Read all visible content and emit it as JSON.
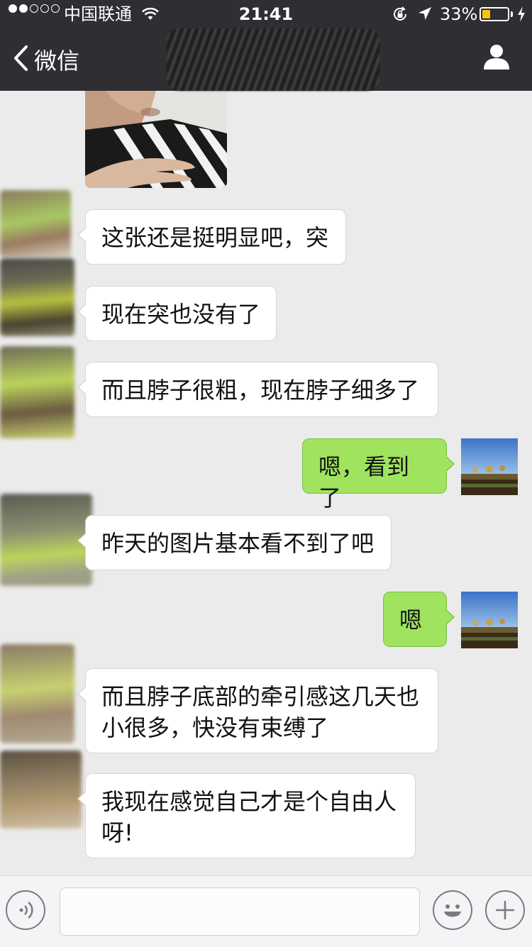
{
  "status_bar": {
    "carrier": "中国联通",
    "time": "21:41",
    "battery_percent": "33%",
    "battery_level": 0.33,
    "signal_bars_filled": 2,
    "signal_bars_total": 5
  },
  "nav": {
    "back_label": "微信",
    "contact_name": ""
  },
  "messages": [
    {
      "side": "in",
      "type": "image"
    },
    {
      "side": "in",
      "text": "这张还是挺明显吧，突"
    },
    {
      "side": "in",
      "text": "现在突也没有了"
    },
    {
      "side": "in",
      "text": "而且脖子很粗，现在脖子细多了"
    },
    {
      "side": "out",
      "text": "嗯，看到了"
    },
    {
      "side": "in",
      "text": "昨天的图片基本看不到了吧"
    },
    {
      "side": "out",
      "text": "嗯"
    },
    {
      "side": "in",
      "text": "而且脖子底部的牵引感这几天也小很多，快没有束缚了"
    },
    {
      "side": "in",
      "text": "我现在感觉自己才是个自由人呀!"
    }
  ],
  "input": {
    "value": "",
    "placeholder": ""
  },
  "icons": {
    "back": "chevron-left-icon",
    "profile": "person-icon",
    "voice": "voice-icon",
    "emoji": "emoji-icon",
    "plus": "plus-icon"
  },
  "colors": {
    "nav_bg": "#2e2e33",
    "chat_bg": "#ebebeb",
    "bubble_in": "#ffffff",
    "bubble_out": "#9fe35f",
    "battery_fill": "#f6c40e"
  }
}
